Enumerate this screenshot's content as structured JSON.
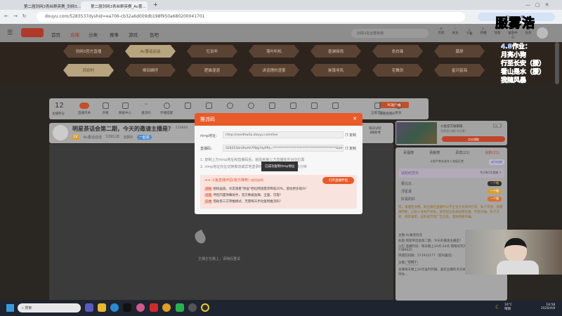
{
  "browser": {
    "tabs": [
      "第二届剑网3青丝群英赛_剑网3...",
      "第二届剑网3青丝群英赛_Ac蕾..."
    ],
    "url": "douyu.com/5283537dyshid=ea706-cb32a6d009db198f950a680200041701",
    "profile": "Chrome 可用"
  },
  "site": {
    "nav": [
      "首页",
      "直播",
      "分类 ·",
      "赛事",
      "游戏 ·",
      "鱼吧"
    ],
    "search_placeholder": "剑网3青丝群英赛",
    "header_icons": [
      "历史",
      "关注",
      "下载",
      "开播",
      "消息",
      "鲨鱼中心",
      "任务"
    ]
  },
  "banner": {
    "row1": [
      "剑网3官方直播",
      "Ac蕾话话话",
      "忆旧年",
      "落叶听松",
      "墨渊探雨",
      "俞白锋",
      "慕辞"
    ],
    "row2": [
      "风初时",
      "柳间撷抒",
      "肥猫混混",
      "讲道理的渣蕾",
      "挨饿寻风",
      "花舞剑",
      "星河皆海"
    ],
    "selected": [
      "Ac蕾话话话",
      "风初时"
    ]
  },
  "toolbar": {
    "score": "12",
    "score_label": "主播积分",
    "items": [
      "直播开关",
      "开播",
      "数据中心",
      "推流码",
      "开播提醒",
      "",
      "",
      "",
      "",
      "",
      "",
      "",
      "",
      "正版音乐",
      "更多"
    ],
    "pc_button": "PC助手端",
    "right_label": "主播直播间"
  },
  "room": {
    "title": "明星茶话会第二期，今天的邀请主播是？",
    "streamer": "Ac蕾话话话",
    "hot": "539118",
    "category": "剑网3",
    "tag": "一起看",
    "followers": "150894",
    "daily": "每日试玩",
    "daily_value": "20分卡"
  },
  "video": {
    "status": "主播正在路上，请稍后重试"
  },
  "ad": {
    "title": "斗鱼官方独家版",
    "subtitle": "免费领大额0卡优惠!",
    "tag": "广告",
    "button": "点击领取"
  },
  "chat": {
    "tabs": [
      "百福榜",
      "贡献榜",
      "贵宾(21)",
      "钻粉(21)"
    ],
    "notice": "斗鱼严禁未成年人充值打赏",
    "become_fan": "成为钻粉",
    "fan_day": "钻粉纪念日",
    "fan_day_right": "今日有1位首座 >",
    "fans": [
      "霍北北",
      "淳星溪",
      "好说的红"
    ],
    "fan_badge": "一个帽",
    "warning": "等。请理性消费，如主播在直播中以不正当方式诱导打赏、私下交易，请谨慎判断，以防人身财产损失。请勿轻信各类招聘征婚、代练代抽、私下交易、刷单兼职、返利成币等广告信息，谨防网络诈骗。",
    "info": [
      [
        "主播",
        "Ac蕾话话话"
      ],
      [
        "标题",
        "明星茶话会第二期，今天的邀请主播是？"
      ],
      [
        "公告",
        "直播时间：每天晚上20点-24点 萌萌的荧光棒帕 聊天技术群：7389425"
      ],
      [
        "",
        "牌遇造知群：571922177（密码蕾话）"
      ]
    ],
    "host_label": "主播",
    "host_name": "剑网3",
    "last_msg": "主播每天晚上20点准时开播，喜欢主播的点点关注，每天晚上锁定直播间，带你..."
  },
  "modal": {
    "title": "推流码",
    "rtmp_label": "rtmp地址：",
    "rtmp_value": "rtmp://sendhw3a.douyu.com/live",
    "code_label": "直播码：",
    "code_value": "5283534rdXoAh7PBg?dyPRt=****************************************&dmrecognition=",
    "copy": "复制",
    "tips": [
      "1. 复制上方rtmp地址和直播码后，粘贴到第三方直播软件对应位置",
      "2. rtmp地址仅在切换推流或异地登录时变化，直播码有效期为5分钟"
    ],
    "toast": "已成功复制rtmp地址",
    "promo_title": "斗鱼直播伴侣(官方推荐)",
    "promo_link": "(使用说明)",
    "promo_button": "打开直播伴侣",
    "features": [
      [
        "流畅",
        "相同画质，水友观看\"原画\"档位网速需求降低20%，留住更多观众！"
      ],
      [
        "可靠",
        "伴侣内置弹幕助手，官方数据准确、全面、可靠！"
      ],
      [
        "方便",
        "借助第三方转推模式，无需每天手动复制推流码！"
      ]
    ]
  },
  "overlay": {
    "title": "服雾浩",
    "lines": [
      "4.8作业：",
      "月亮小狗",
      "行至长安（援）",
      "看山是水（援）",
      "我随风暴"
    ]
  },
  "taskbar": {
    "search": "搜索",
    "weather": "16°C",
    "weather_desc": "晴朗",
    "time": "18:58",
    "date": "2026/4/8"
  }
}
